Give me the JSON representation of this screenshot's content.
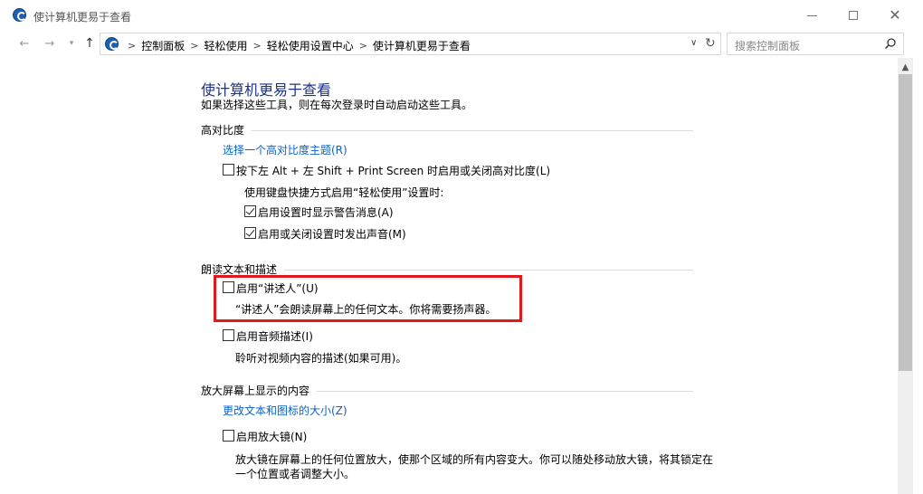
{
  "window": {
    "title": "使计算机更易于查看",
    "minimize": "—",
    "maximize": "□",
    "close": "✕"
  },
  "nav": {
    "back_icon": "←",
    "forward_icon": "→",
    "history_icon": "▾",
    "up_icon": "↑"
  },
  "address": {
    "crumbs": [
      "控制面板",
      "轻松使用",
      "轻松使用设置中心",
      "使计算机更易于查看"
    ],
    "separator": ">"
  },
  "search": {
    "placeholder": "搜索控制面板"
  },
  "page": {
    "title": "使计算机更易于查看",
    "subtitle": "如果选择这些工具，则在每次登录时自动启动这些工具。"
  },
  "sections": {
    "contrast": {
      "heading": "高对比度",
      "link": "选择一个高对比度主题(R)",
      "checkbox_label": "按下左 Alt + 左 Shift + Print Screen 时启用或关闭高对比度(L)",
      "checkbox_checked": false,
      "shortcut_note": "使用键盘快捷方式启用“轻松使用”设置时:",
      "warn_label": "启用设置时显示警告消息(A)",
      "warn_checked": true,
      "sound_label": "启用或关闭设置时发出声音(M)",
      "sound_checked": true
    },
    "narration": {
      "heading": "朗读文本和描述",
      "narrator_label": "启用“讲述人”(U)",
      "narrator_checked": false,
      "narrator_desc": "“讲述人”会朗读屏幕上的任何文本。你将需要扬声器。",
      "audio_desc_label": "启用音频描述(I)",
      "audio_desc_checked": false,
      "audio_desc_note": "聆听对视频内容的描述(如果可用)。"
    },
    "magnify": {
      "heading": "放大屏幕上显示的内容",
      "link": "更改文本和图标的大小(Z)",
      "magnifier_label": "启用放大镜(N)",
      "magnifier_checked": false,
      "magnifier_desc_1": "放大镜在屏幕上的任何位置放大，使那个区域的所有内容变大。你可以随处移动放大镜，将其锁定在",
      "magnifier_desc_2": "一个位置或者调整大小。"
    }
  },
  "colors": {
    "title_blue": "#1e3287",
    "link_blue": "#0b62c9",
    "highlight_red": "#e0191f"
  }
}
